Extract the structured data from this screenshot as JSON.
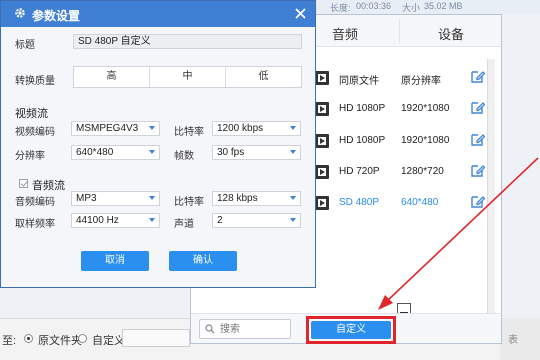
{
  "background": {
    "topbar": {
      "duration_value": "00:03:36",
      "size_label": "大小",
      "size_value": "35.02 MB",
      "length_label": "长度:"
    },
    "bottom_bar": {
      "to_label": "至:",
      "option_original": "原文件夹",
      "option_custom": "自定义",
      "right_text": "表"
    }
  },
  "format_panel": {
    "columns": [
      "音频",
      "设备"
    ],
    "rows": [
      {
        "name": "同原文件",
        "resolution": "原分辨率"
      },
      {
        "name": "HD 1080P",
        "resolution": "1920*1080"
      },
      {
        "name": "HD 1080P",
        "resolution": "1920*1080"
      },
      {
        "name": "HD 720P",
        "resolution": "1280*720"
      },
      {
        "name": "SD 480P",
        "resolution": "640*480"
      }
    ],
    "selected_row": 4,
    "search_placeholder": "搜索",
    "custom_button": "自定义"
  },
  "dialog": {
    "title": "参数设置",
    "title_label": "标题",
    "title_value": "SD 480P 自定义",
    "quality_label": "转换质量",
    "quality_options": [
      "高",
      "中",
      "低"
    ],
    "video_section": "视频流",
    "video_codec_label": "视频编码",
    "video_codec": "MSMPEG4V3",
    "bitrate_label": "比特率",
    "video_bitrate": "1200 kbps",
    "resolution_label": "分辨率",
    "resolution": "640*480",
    "framerate_label": "帧数",
    "framerate": "30 fps",
    "audio_section": "音频流",
    "audio_codec_label": "音频编码",
    "audio_codec": "MP3",
    "audio_bitrate": "128 kbps",
    "samplerate_label": "取样频率",
    "samplerate": "44100 Hz",
    "channel_label": "声道",
    "channel": "2",
    "cancel_label": "取消",
    "confirm_label": "确认"
  },
  "colors": {
    "accent": "#3f7fd4",
    "button": "#2b8ff0",
    "highlight": "#e0262c",
    "selected_text": "#2a8cf0"
  }
}
